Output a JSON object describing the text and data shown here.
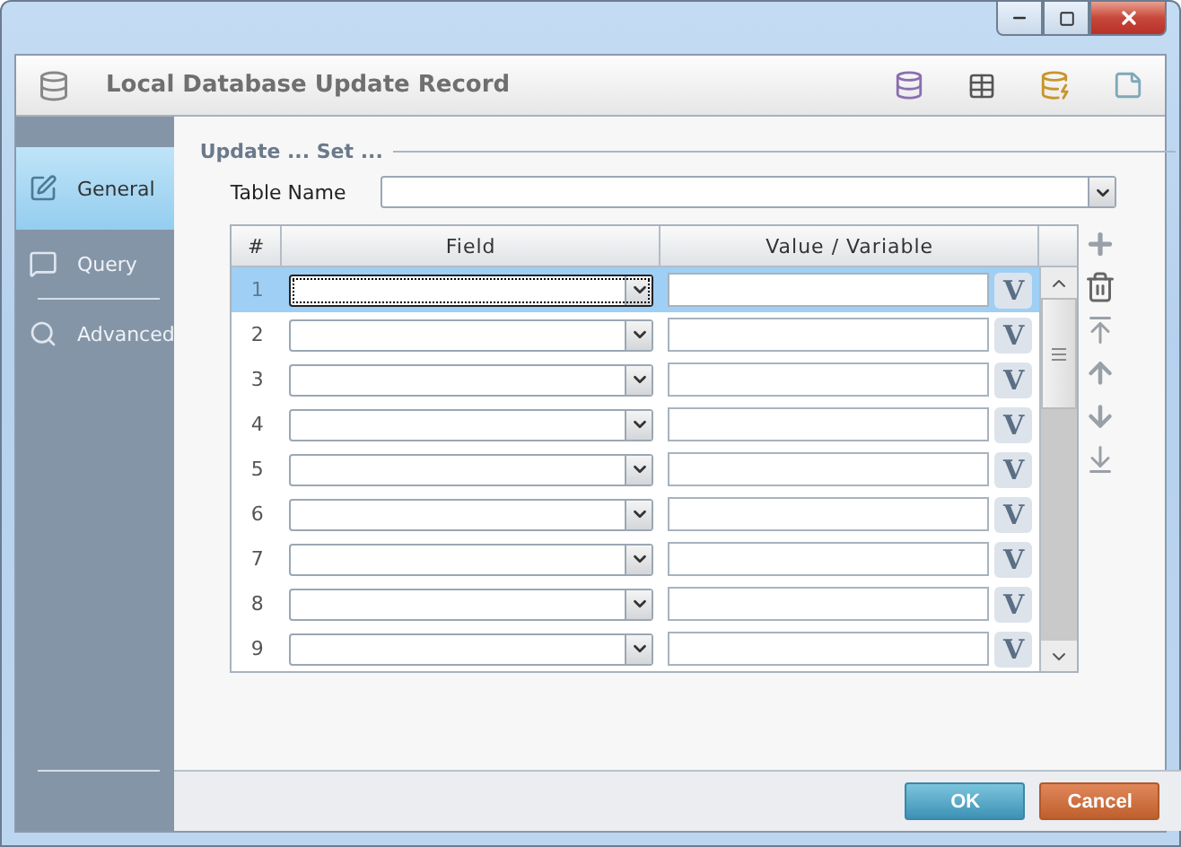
{
  "header": {
    "title": "Local Database Update Record"
  },
  "sidebar": {
    "items": [
      {
        "label": "General",
        "selected": true,
        "kind": "edit"
      },
      {
        "label": "Query",
        "selected": false,
        "kind": "query"
      },
      {
        "label": "Advanced",
        "selected": false,
        "kind": "search"
      }
    ]
  },
  "section": {
    "title": "Update ... Set ..."
  },
  "table_name": {
    "label": "Table Name"
  },
  "table": {
    "columns": [
      "#",
      "Field",
      "Value / Variable"
    ],
    "rows": [
      {
        "number": "1",
        "selected": true,
        "variable_button": "V"
      },
      {
        "number": "2",
        "selected": false,
        "variable_button": "V"
      },
      {
        "number": "3",
        "selected": false,
        "variable_button": "V"
      },
      {
        "number": "4",
        "selected": false,
        "variable_button": "V"
      },
      {
        "number": "5",
        "selected": false,
        "variable_button": "V"
      },
      {
        "number": "6",
        "selected": false,
        "variable_button": "V"
      },
      {
        "number": "7",
        "selected": false,
        "variable_button": "V"
      },
      {
        "number": "8",
        "selected": false,
        "variable_button": "V"
      },
      {
        "number": "9",
        "selected": false,
        "variable_button": "V"
      }
    ]
  },
  "buttons": [
    {
      "label": "OK",
      "kind": "primary"
    },
    {
      "label": "Cancel",
      "kind": "cancel"
    }
  ]
}
